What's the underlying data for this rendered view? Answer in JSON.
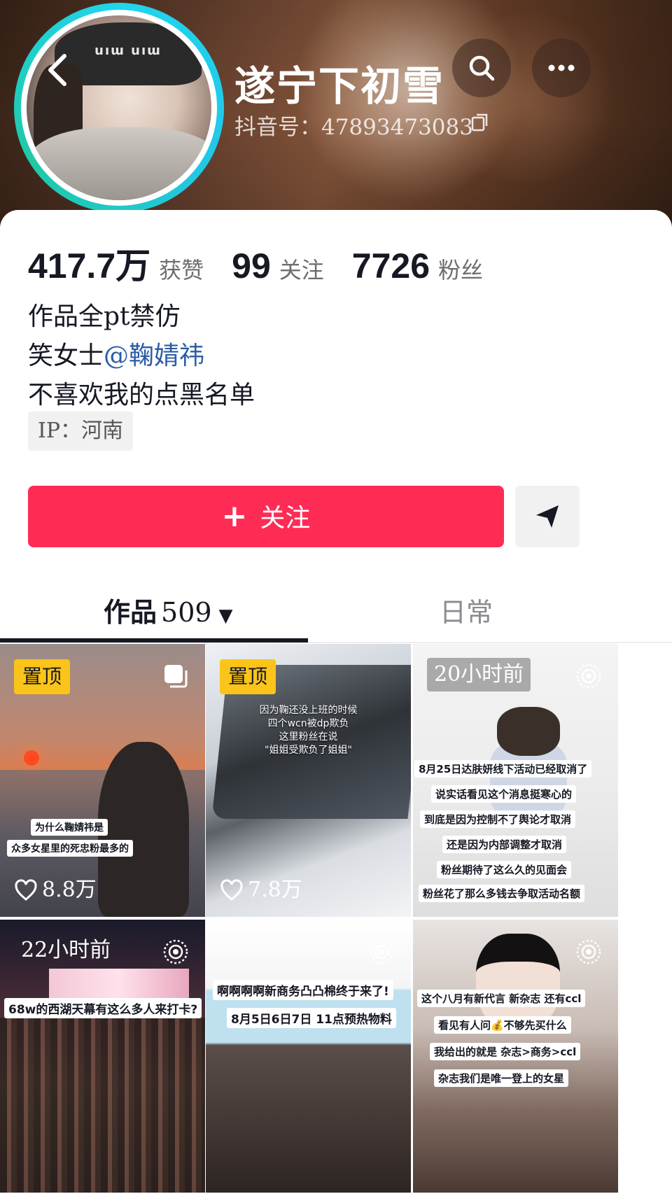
{
  "profile": {
    "name": "遂宁下初雪",
    "douyin_id": "抖音号：47893473083",
    "avatar_hat_text": "uıɯ uıɯ"
  },
  "stats": {
    "likes": {
      "value": "417.7万",
      "label": "获赞"
    },
    "following": {
      "value": "99",
      "label": "关注"
    },
    "followers": {
      "value": "7726",
      "label": "粉丝"
    }
  },
  "bio": {
    "line1": "作品全pt禁仿",
    "line2_prefix": "笑女士",
    "line2_mention": "@鞠婧祎",
    "line3": "不喜欢我的点黑名单"
  },
  "ip": "IP：河南",
  "actions": {
    "follow_label": "关注",
    "follow_icon": "plus-icon",
    "share_icon": "send-icon"
  },
  "tabs": {
    "works_label": "作品",
    "works_count": "509",
    "daily_label": "日常"
  },
  "videos": [
    {
      "badge": "置顶",
      "likes": "8.8万",
      "caption1": "为什么鞠婧祎是",
      "caption2": "众多女星里的死忠粉最多的"
    },
    {
      "badge": "置顶",
      "likes": "7.8万",
      "caption1": "因为鞠还没上班的时候",
      "caption2": "四个wcn被dp欺负",
      "caption3": "这里粉丝在说",
      "caption4": "\"姐姐受欺负了姐姐\""
    },
    {
      "time": "20小时前",
      "lines": [
        "8月25日达肤妍线下活动已经取消了",
        "说实话看见这个消息挺寒心的",
        "到底是因为控制不了舆论才取消",
        "还是因为内部调整才取消",
        "粉丝期待了这么久的见面会",
        "粉丝花了那么多钱去争取活动名额"
      ]
    },
    {
      "time": "22小时前",
      "caption1": "68w的西湖天幕有这么多人来打卡?"
    },
    {
      "caption1": "啊啊啊啊新商务凸凸棉终于来了!",
      "caption2": "8月5日6日7日 11点预热物料"
    },
    {
      "lines": [
        "这个八月有新代言 新杂志 还有ccl",
        "看见有人问💰不够先买什么",
        "我给出的就是 杂志>商务>ccl",
        "杂志我们是唯一登上的女星"
      ]
    }
  ],
  "colors": {
    "accent": "#fe2c55",
    "pinned": "#fac41a",
    "mention": "#2b5ca5",
    "avatar_ring": "#20d5ec"
  }
}
